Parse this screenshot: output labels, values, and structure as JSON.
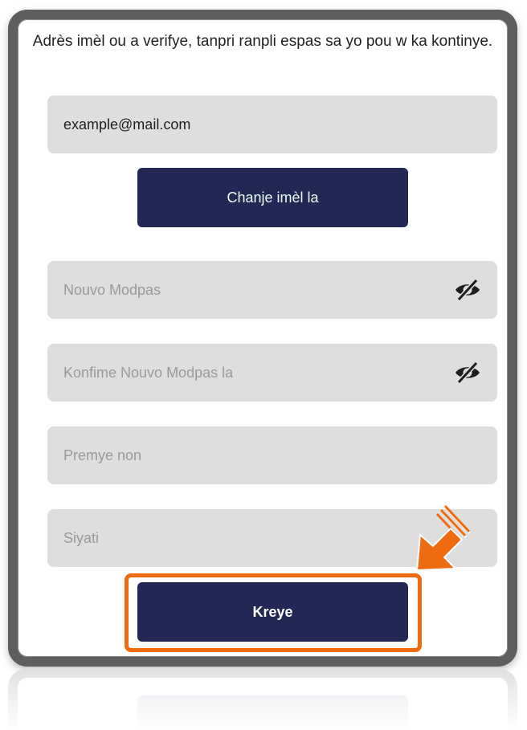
{
  "form": {
    "instruction": "Adrès imèl ou a verifye, tanpri ranpli espas sa yo pou w ka kontinye.",
    "email_value": "example@mail.com",
    "change_email_label": "Chanje imèl la",
    "new_password_placeholder": "Nouvo Modpas",
    "confirm_password_placeholder": "Konfime Nouvo Modpas la",
    "first_name_placeholder": "Premye non",
    "last_name_placeholder": "Siyati",
    "create_label": "Kreye"
  },
  "icons": {
    "password_toggle": "eye-slash-icon",
    "pointer": "arrow-down-left-icon"
  },
  "colors": {
    "button_bg": "#222755",
    "field_bg": "#dedede",
    "highlight": "#ef6b10",
    "frame": "#5e5e5e"
  }
}
